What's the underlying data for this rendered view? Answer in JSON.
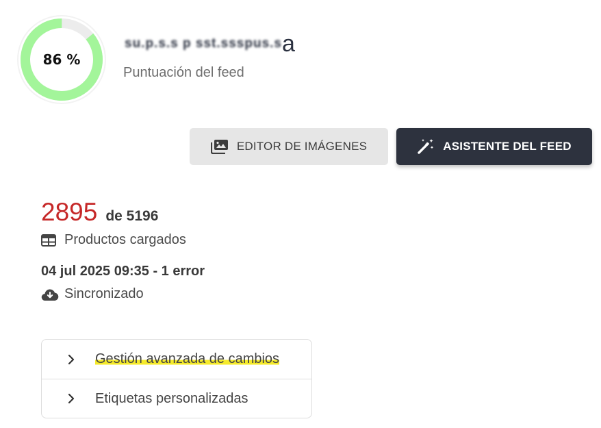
{
  "score": {
    "value": 86,
    "label": "86 %",
    "ring_color": "#a3f59a",
    "track_color": "#ececec"
  },
  "feed": {
    "title_visible_tail": "a",
    "title_obscured": "ѕu.p.ѕ.ѕ p ѕѕt.ѕѕѕpuѕ.ѕ",
    "subtitle": "Puntuación del feed"
  },
  "buttons": {
    "image_editor": {
      "label": "EDITOR DE IMÁGENES",
      "icon": "images-icon"
    },
    "feed_wizard": {
      "label": "ASISTENTE DEL FEED",
      "icon": "magic-wand-icon"
    }
  },
  "products": {
    "loaded": "2895",
    "total": "de 5196",
    "label": "Productos cargados",
    "icon": "table-icon",
    "loaded_color": "#c62828"
  },
  "sync": {
    "timestamp": "04 jul 2025 09:35 - 1 error",
    "status": "Sincronizado",
    "icon": "cloud-download-icon"
  },
  "accordion": {
    "items": [
      {
        "label": "Gestión avanzada de cambios",
        "highlighted": true
      },
      {
        "label": "Etiquetas personalizadas",
        "highlighted": false
      }
    ]
  }
}
